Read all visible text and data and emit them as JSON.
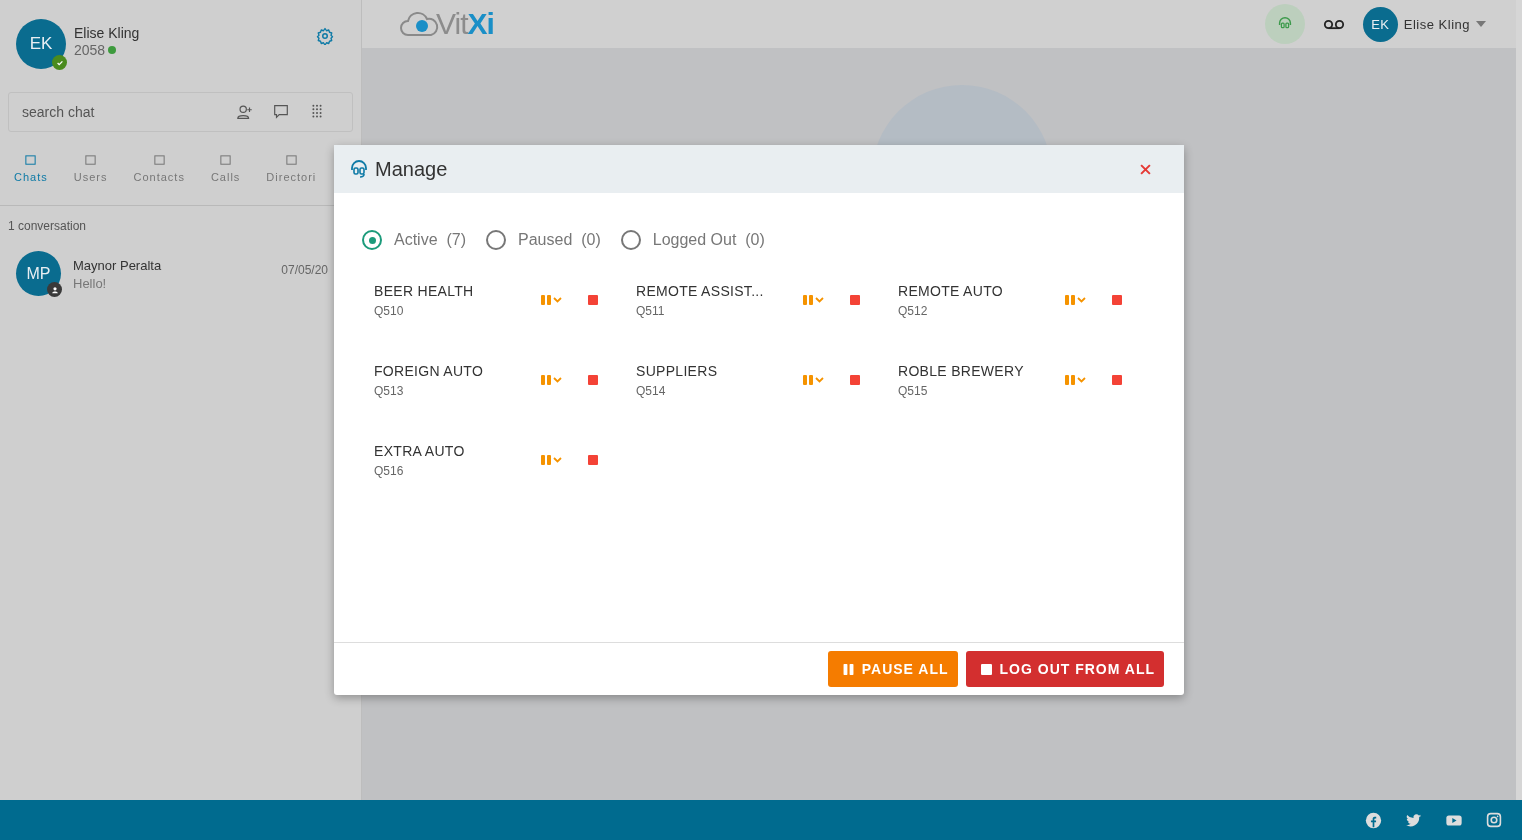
{
  "profile": {
    "initials": "EK",
    "name": "Elise Kling",
    "extension": "2058",
    "online": true
  },
  "search": {
    "placeholder": "search chat"
  },
  "tabs": [
    {
      "label": "Chats",
      "selected": true
    },
    {
      "label": "Users",
      "selected": false
    },
    {
      "label": "Contacts",
      "selected": false
    },
    {
      "label": "Calls",
      "selected": false
    },
    {
      "label": "Directori",
      "selected": false
    }
  ],
  "conversation_count": "1 conversation",
  "conversations": [
    {
      "initials": "MP",
      "name": "Maynor Peralta",
      "message": "Hello!",
      "date": "07/05/20"
    }
  ],
  "logo": {
    "part_1": "Vit",
    "part_2": "Xi"
  },
  "topbar": {
    "initials": "EK",
    "user": "Elise Kling"
  },
  "modal": {
    "title": "Manage",
    "filters": [
      {
        "label": "Active",
        "count": "(7)",
        "selected": true
      },
      {
        "label": "Paused",
        "count": "(0)",
        "selected": false
      },
      {
        "label": "Logged Out",
        "count": "(0)",
        "selected": false
      }
    ],
    "queues": [
      {
        "name": "BEER HEALTH",
        "code": "Q510"
      },
      {
        "name": "REMOTE ASSIST...",
        "code": "Q511"
      },
      {
        "name": "REMOTE AUTO",
        "code": "Q512"
      },
      {
        "name": "FOREIGN AUTO",
        "code": "Q513"
      },
      {
        "name": "SUPPLIERS",
        "code": "Q514"
      },
      {
        "name": "ROBLE BREWERY",
        "code": "Q515"
      },
      {
        "name": "EXTRA AUTO",
        "code": "Q516"
      }
    ],
    "buttons": [
      {
        "kind": "pause",
        "label": "PAUSE ALL"
      },
      {
        "kind": "logout",
        "label": "LOG OUT FROM ALL"
      }
    ]
  }
}
